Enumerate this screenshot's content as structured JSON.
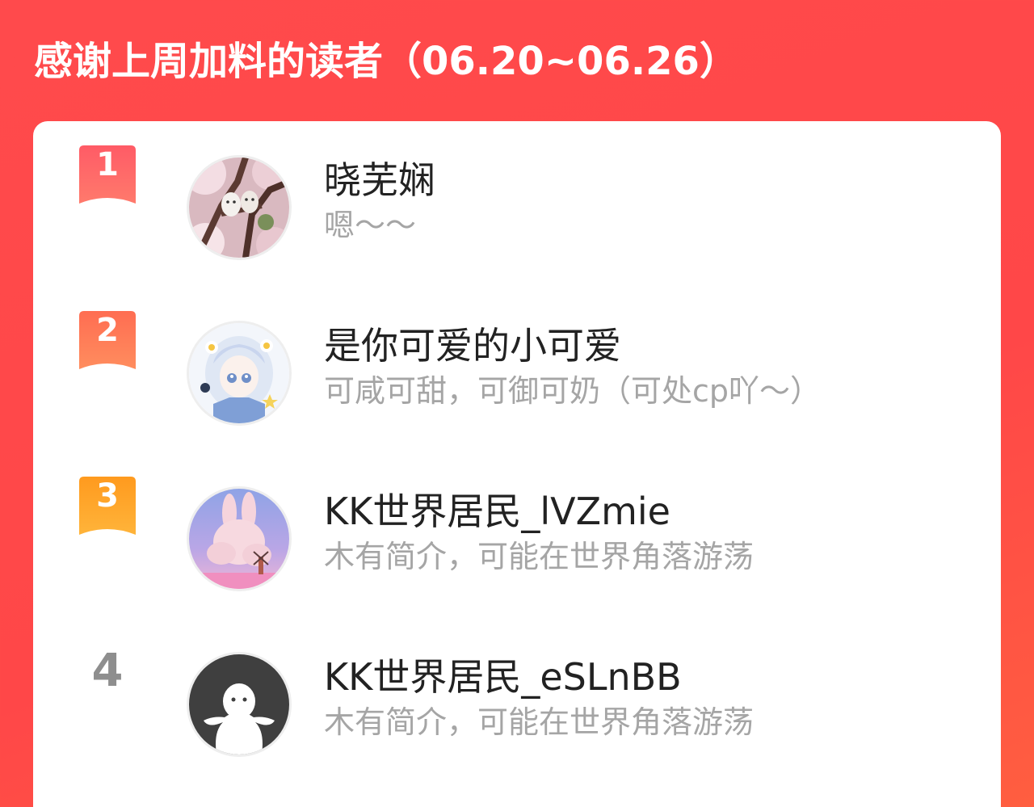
{
  "header": {
    "title": "感谢上周加料的读者（06.20~06.26）"
  },
  "colors": {
    "background": "#ff4a4c",
    "rank1": "#ff5a60",
    "rank2": "#ff7a52",
    "rank3": "#ff9d28",
    "rank_plain": "#8e8e8e",
    "name": "#222222",
    "bio": "#a5a5a5"
  },
  "readers": [
    {
      "rank": "1",
      "name": "晓芜娴",
      "bio": "嗯～～",
      "avatar_icon": "avatar-cats-in-blossom-tree"
    },
    {
      "rank": "2",
      "name": "是你可爱的小可爱",
      "bio": "可咸可甜，可御可奶（可处cp吖～）",
      "avatar_icon": "avatar-anime-girl"
    },
    {
      "rank": "3",
      "name": "KK世界居民_lVZmie",
      "bio": "木有简介，可能在世界角落游荡",
      "avatar_icon": "avatar-pink-cloud-bunny"
    },
    {
      "rank": "4",
      "name": "KK世界居民_eSLnBB",
      "bio": "木有简介，可能在世界角落游荡",
      "avatar_icon": "avatar-default-ghost"
    }
  ]
}
